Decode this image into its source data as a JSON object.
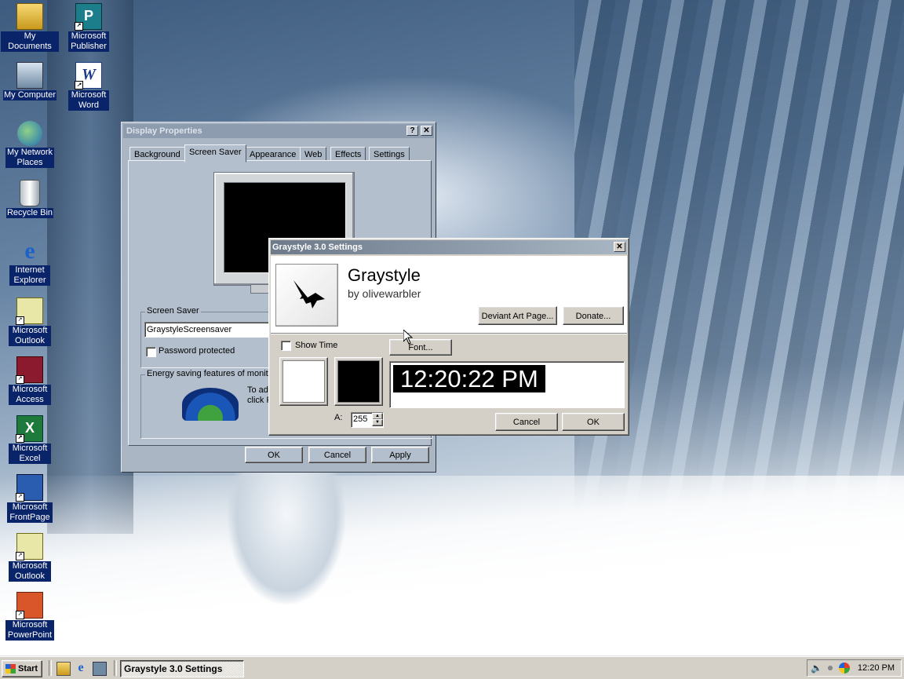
{
  "desktop": {
    "icons": [
      {
        "label": "My Documents",
        "icon": "my-documents-icon"
      },
      {
        "label": "My Computer",
        "icon": "my-computer-icon"
      },
      {
        "label": "My Network Places",
        "icon": "network-places-icon"
      },
      {
        "label": "Recycle Bin",
        "icon": "recycle-bin-icon"
      },
      {
        "label": "Internet Explorer",
        "icon": "internet-explorer-icon"
      },
      {
        "label": "Microsoft Outlook",
        "icon": "outlook-icon"
      },
      {
        "label": "Microsoft Access",
        "icon": "access-icon"
      },
      {
        "label": "Microsoft Excel",
        "icon": "excel-icon"
      },
      {
        "label": "Microsoft FrontPage",
        "icon": "frontpage-icon"
      },
      {
        "label": "Microsoft Outlook",
        "icon": "outlook-icon"
      },
      {
        "label": "Microsoft PowerPoint",
        "icon": "powerpoint-icon"
      },
      {
        "label": "Microsoft Publisher",
        "icon": "publisher-icon"
      },
      {
        "label": "Microsoft Word",
        "icon": "word-icon"
      }
    ]
  },
  "display_properties": {
    "title": "Display Properties",
    "help_btn": "?",
    "close_btn": "✕",
    "tabs": [
      "Background",
      "Screen Saver",
      "Appearance",
      "Web",
      "Effects",
      "Settings"
    ],
    "active_tab": "Screen Saver",
    "screen_saver_group": "Screen Saver",
    "screen_saver_value": "GraystyleScreensaver",
    "password_protected": "Password protected",
    "energy_group": "Energy saving features of monito",
    "energy_text_1": "To adjust",
    "energy_text_2": "click Pow",
    "ok": "OK",
    "cancel": "Cancel",
    "apply": "Apply"
  },
  "graystyle": {
    "title": "Graystyle 3.0 Settings",
    "close_btn": "✕",
    "app_name": "Graystyle",
    "author": "by olivewarbler",
    "deviant_art_btn": "Deviant Art Page...",
    "donate_btn": "Donate...",
    "show_time": "Show Time",
    "font_btn": "Font...",
    "preview_time": "12:20:22 PM",
    "alpha_label": "A:",
    "alpha_value": "255",
    "cancel": "Cancel",
    "ok": "OK",
    "colors": {
      "foreground": "#ffffff",
      "background": "#000000",
      "titlebar": "#6d7a8a"
    }
  },
  "taskbar": {
    "start": "Start",
    "task": "Graystyle 3.0 Settings",
    "clock": "12:20 PM"
  }
}
